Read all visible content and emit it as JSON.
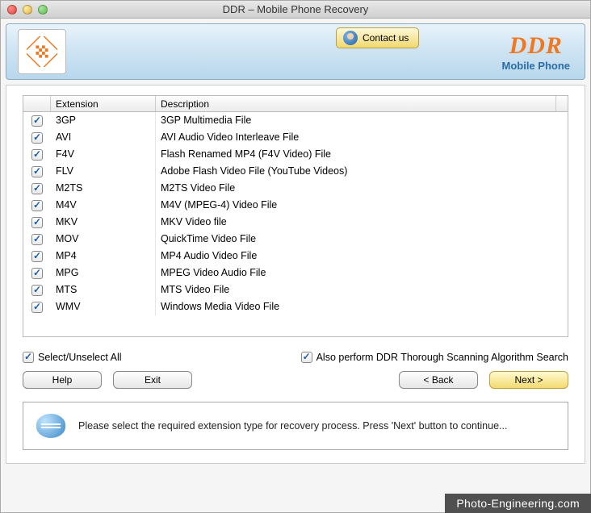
{
  "window": {
    "title": "DDR – Mobile Phone Recovery"
  },
  "header": {
    "contact_label": "Contact us",
    "brand_top": "DDR",
    "brand_sub": "Mobile Phone"
  },
  "table": {
    "headers": {
      "extension": "Extension",
      "description": "Description"
    },
    "rows": [
      {
        "checked": true,
        "ext": "3GP",
        "desc": "3GP Multimedia File"
      },
      {
        "checked": true,
        "ext": "AVI",
        "desc": "AVI Audio Video Interleave File"
      },
      {
        "checked": true,
        "ext": "F4V",
        "desc": "Flash Renamed MP4 (F4V Video) File"
      },
      {
        "checked": true,
        "ext": "FLV",
        "desc": "Adobe Flash Video File (YouTube Videos)"
      },
      {
        "checked": true,
        "ext": "M2TS",
        "desc": "M2TS Video File"
      },
      {
        "checked": true,
        "ext": "M4V",
        "desc": "M4V (MPEG-4) Video File"
      },
      {
        "checked": true,
        "ext": "MKV",
        "desc": "MKV Video file"
      },
      {
        "checked": true,
        "ext": "MOV",
        "desc": "QuickTime Video File"
      },
      {
        "checked": true,
        "ext": "MP4",
        "desc": "MP4 Audio Video File"
      },
      {
        "checked": true,
        "ext": "MPG",
        "desc": "MPEG Video Audio File"
      },
      {
        "checked": true,
        "ext": "MTS",
        "desc": "MTS Video File"
      },
      {
        "checked": true,
        "ext": "WMV",
        "desc": "Windows Media Video File"
      }
    ]
  },
  "controls": {
    "select_all": "Select/Unselect All",
    "thorough": "Also perform DDR Thorough Scanning Algorithm Search"
  },
  "buttons": {
    "help": "Help",
    "exit": "Exit",
    "back": "< Back",
    "next": "Next >"
  },
  "hint": "Please select the required extension type for recovery process. Press 'Next' button to continue...",
  "footer": "Photo-Engineering.com"
}
